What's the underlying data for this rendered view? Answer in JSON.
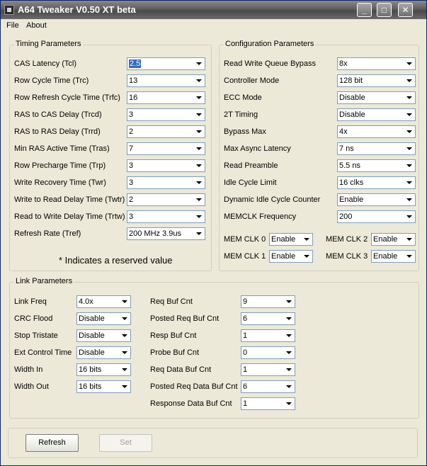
{
  "window": {
    "title": "A64 Tweaker V0.50 XT beta"
  },
  "titlebar": {
    "minimize_glyph": "_",
    "maximize_glyph": "□",
    "close_glyph": "✕"
  },
  "menu": {
    "file": "File",
    "about": "About"
  },
  "timing": {
    "title": "Timing Parameters",
    "rows": [
      {
        "label": "CAS Latency (Tcl)",
        "value": "2.5",
        "selected": true
      },
      {
        "label": "Row Cycle Time (Trc)",
        "value": "13"
      },
      {
        "label": "Row Refresh Cycle Time (Trfc)",
        "value": "16"
      },
      {
        "label": "RAS to CAS Delay (Trcd)",
        "value": "3"
      },
      {
        "label": "RAS to RAS Delay (Trrd)",
        "value": "2"
      },
      {
        "label": "Min RAS Active Time (Tras)",
        "value": "7"
      },
      {
        "label": "Row Precharge Time (Trp)",
        "value": "3"
      },
      {
        "label": "Write Recovery Time (Twr)",
        "value": "3"
      },
      {
        "label": "Write to Read Delay Time (Twtr)",
        "value": "2"
      },
      {
        "label": "Read to Write Delay Time (Trtw)",
        "value": "3"
      },
      {
        "label": "Refresh Rate (Tref)",
        "value": "200 MHz 3.9us"
      }
    ],
    "note": "* Indicates a reserved value"
  },
  "config": {
    "title": "Configuration Parameters",
    "rows": [
      {
        "label": "Read Write Queue Bypass",
        "value": "8x"
      },
      {
        "label": "Controller Mode",
        "value": "128 bit"
      },
      {
        "label": "ECC Mode",
        "value": "Disable"
      },
      {
        "label": "2T Timing",
        "value": "Disable"
      },
      {
        "label": "Bypass Max",
        "value": "4x"
      },
      {
        "label": "Max Async Latency",
        "value": "7 ns"
      },
      {
        "label": "Read Preamble",
        "value": "5.5 ns"
      },
      {
        "label": "Idle Cycle Limit",
        "value": "16 clks"
      },
      {
        "label": "Dynamic Idle Cycle Counter",
        "value": "Enable"
      },
      {
        "label": "MEMCLK Frequency",
        "value": "200"
      }
    ],
    "memclk": [
      {
        "label": "MEM CLK 0",
        "value": "Enable"
      },
      {
        "label": "MEM CLK 2",
        "value": "Enable"
      },
      {
        "label": "MEM CLK 1",
        "value": "Enable"
      },
      {
        "label": "MEM CLK 3",
        "value": "Enable"
      }
    ]
  },
  "link": {
    "title": "Link Parameters",
    "left": [
      {
        "label": "Link Freq",
        "value": "4.0x"
      },
      {
        "label": "CRC Flood",
        "value": "Disable"
      },
      {
        "label": "Stop Tristate",
        "value": "Disable"
      },
      {
        "label": "Ext Control Time",
        "value": "Disable"
      },
      {
        "label": "Width In",
        "value": "16 bits"
      },
      {
        "label": "Width Out",
        "value": "16 bits"
      }
    ],
    "right": [
      {
        "label": "Req Buf Cnt",
        "value": "9"
      },
      {
        "label": "Posted Req Buf Cnt",
        "value": "6"
      },
      {
        "label": "Resp Buf Cnt",
        "value": "1"
      },
      {
        "label": "Probe Buf Cnt",
        "value": "0"
      },
      {
        "label": "Req Data Buf Cnt",
        "value": "1"
      },
      {
        "label": "Posted Req Data Buf Cnt",
        "value": "6"
      },
      {
        "label": "Response Data Buf Cnt",
        "value": "1"
      }
    ]
  },
  "buttons": {
    "refresh": "Refresh",
    "set": "Set"
  },
  "colors": {
    "face": "#ECE9D8",
    "selection": "#316AC5",
    "field_border": "#7F9DB9"
  }
}
